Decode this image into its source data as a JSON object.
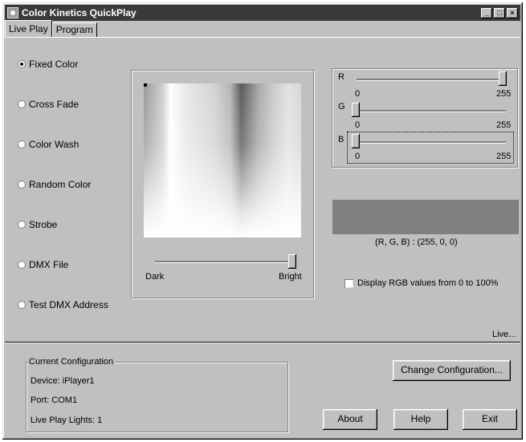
{
  "window": {
    "title": "Color Kinetics QuickPlay",
    "min": "_",
    "max": "□",
    "close": "×"
  },
  "tabs": [
    {
      "label": "Live Play",
      "active": true
    },
    {
      "label": "Program",
      "active": false
    }
  ],
  "modes": [
    {
      "label": "Fixed Color",
      "selected": true
    },
    {
      "label": "Cross Fade",
      "selected": false
    },
    {
      "label": "Color Wash",
      "selected": false
    },
    {
      "label": "Random Color",
      "selected": false
    },
    {
      "label": "Strobe",
      "selected": false
    },
    {
      "label": "DMX File",
      "selected": false
    },
    {
      "label": "Test DMX Address",
      "selected": false
    }
  ],
  "brightness": {
    "min_label": "Dark",
    "max_label": "Bright",
    "value_fraction": 1.0
  },
  "rgb": {
    "r": {
      "label": "R",
      "min": "0",
      "max": "255",
      "value": 255
    },
    "g": {
      "label": "G",
      "min": "0",
      "max": "255",
      "value": 0
    },
    "b": {
      "label": "B",
      "min": "0",
      "max": "255",
      "value": 0
    }
  },
  "preview_color": "#808080",
  "rgb_readout": "(R, G, B) : (255, 0, 0)",
  "percent_checkbox": {
    "label": "Display RGB values from 0 to 100%",
    "checked": false
  },
  "live_status": "Live...",
  "config": {
    "legend": "Current Configuration",
    "device": "Device: iPlayer1",
    "port": "Port: COM1",
    "lights": "Live Play Lights: 1"
  },
  "buttons": {
    "change_config": "Change Configuration...",
    "about": "About",
    "help": "Help",
    "exit": "Exit"
  }
}
